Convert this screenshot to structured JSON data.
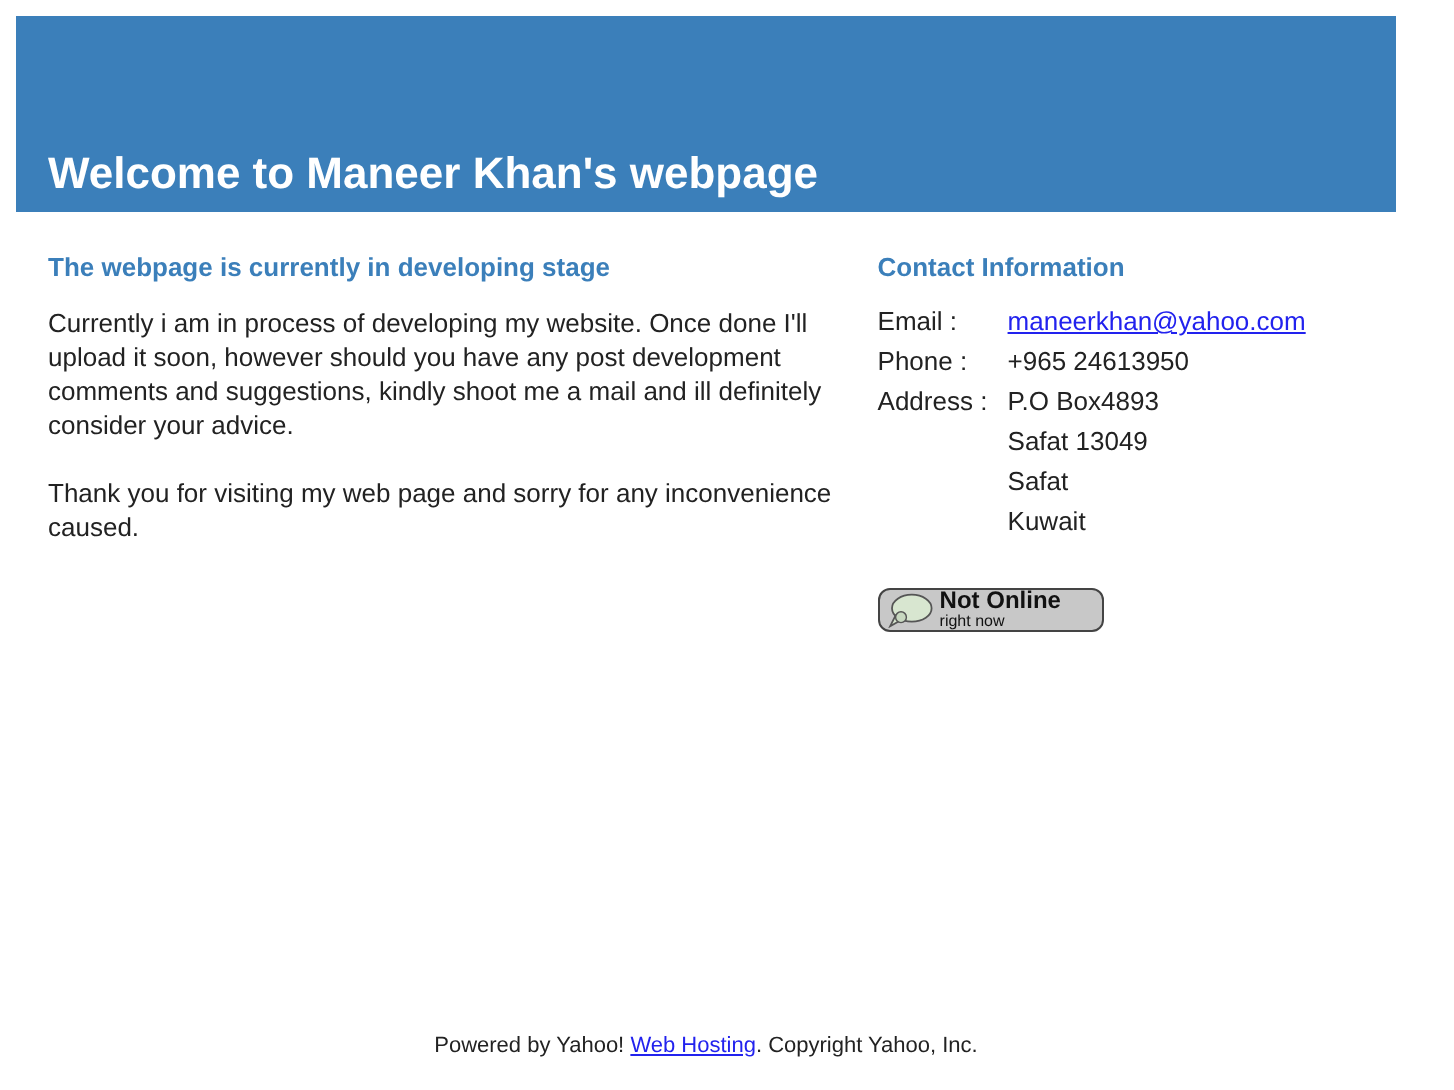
{
  "header": {
    "title": "Welcome to Maneer Khan's webpage"
  },
  "intro": {
    "heading": "The webpage is currently in developing stage",
    "paragraphs": [
      "Currently i am in process of developing my website. Once done I'll upload it soon, however should you have any post development comments and suggestions, kindly shoot me a mail and ill definitely consider your advice.",
      "Thank you for visiting my web page and sorry for any inconvenience caused."
    ]
  },
  "contact": {
    "heading": "Contact Information",
    "rows": [
      {
        "label": "Email :",
        "kind": "link",
        "values": [
          "maneerkhan@yahoo.com"
        ]
      },
      {
        "label": "Phone :",
        "kind": "text",
        "values": [
          "+965 24613950"
        ]
      },
      {
        "label": "Address :",
        "kind": "text",
        "values": [
          "P.O Box4893",
          "Safat 13049",
          "Safat",
          "Kuwait"
        ]
      }
    ],
    "status": {
      "online": false,
      "label": "Not Online",
      "sublabel": "right now"
    }
  },
  "footer": {
    "before": "Powered by Yahoo! ",
    "link": "Web Hosting",
    "after": ". Copyright Yahoo, Inc."
  }
}
